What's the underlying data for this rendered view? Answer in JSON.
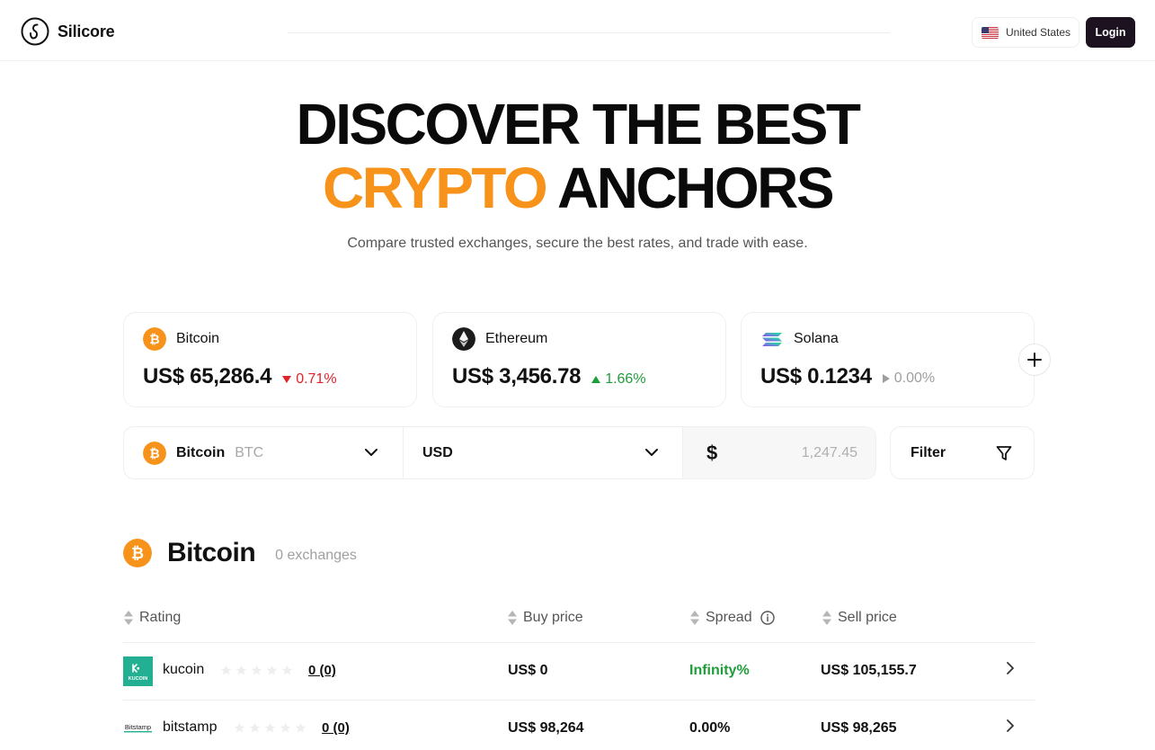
{
  "brand": {
    "name": "Silicore"
  },
  "header": {
    "country": "United States",
    "login_label": "Login"
  },
  "hero": {
    "line1": "DISCOVER THE BEST",
    "line2_accent": "CRYPTO",
    "line2_rest": "ANCHORS",
    "subtitle": "Compare trusted exchanges, secure the best rates, and trade with ease."
  },
  "tickers": [
    {
      "name": "Bitcoin",
      "price": "US$ 65,286.4",
      "change": "0.71%",
      "direction": "down",
      "icon": "bitcoin-icon"
    },
    {
      "name": "Ethereum",
      "price": "US$ 3,456.78",
      "change": "1.66%",
      "direction": "up",
      "icon": "ethereum-icon"
    },
    {
      "name": "Solana",
      "price": "US$ 0.1234",
      "change": "0.00%",
      "direction": "flat",
      "icon": "solana-icon"
    }
  ],
  "converter": {
    "coin_name": "Bitcoin",
    "coin_ticker": "BTC",
    "fiat": "USD",
    "currency_symbol": "$",
    "amount": "1,247.45",
    "filter_label": "Filter"
  },
  "section": {
    "coin_name": "Bitcoin",
    "count_label": "0 exchanges"
  },
  "table": {
    "headers": {
      "rating": "Rating",
      "buy": "Buy price",
      "spread": "Spread",
      "sell": "Sell price"
    },
    "rows": [
      {
        "exchange": "kucoin",
        "reviews": "0 (0)",
        "rating": 0,
        "buy": "US$ 0",
        "spread": "Infinity%",
        "spread_positive": true,
        "sell": "US$ 105,155.7"
      },
      {
        "exchange": "bitstamp",
        "reviews": "0 (0)",
        "rating": 0,
        "buy": "US$ 98,264",
        "spread": "0.00%",
        "spread_positive": false,
        "sell": "US$ 98,265"
      }
    ]
  },
  "colors": {
    "accent": "#f7931a",
    "down": "#e0222b",
    "up": "#1f9d3a",
    "login_bg": "#1c1220",
    "kucoin": "#23af91"
  }
}
